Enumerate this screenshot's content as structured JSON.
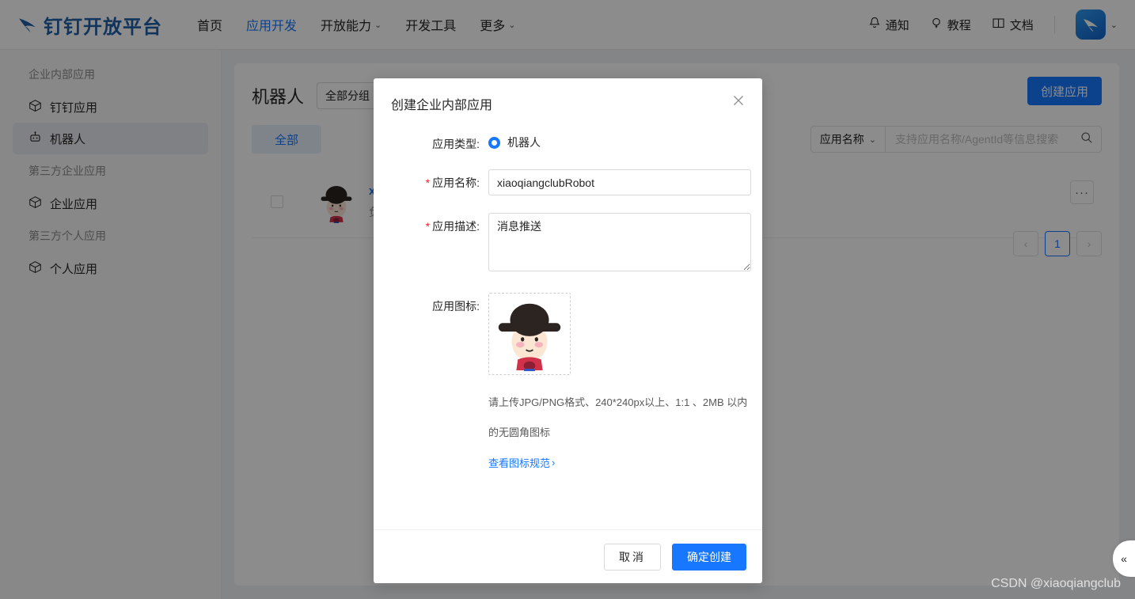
{
  "header": {
    "logo_text": "钉钉开放平台",
    "logo_icon": "dingtalk-wing-logo",
    "nav": [
      {
        "label": "首页",
        "active": false,
        "caret": ""
      },
      {
        "label": "应用开发",
        "active": true,
        "caret": ""
      },
      {
        "label": "开放能力",
        "active": false,
        "caret": "⌄"
      },
      {
        "label": "开发工具",
        "active": false,
        "caret": ""
      },
      {
        "label": "更多",
        "active": false,
        "caret": "⌄"
      }
    ],
    "tools": [
      {
        "label": "通知",
        "icon": "bell-icon"
      },
      {
        "label": "教程",
        "icon": "lightbulb-icon"
      },
      {
        "label": "文档",
        "icon": "book-icon"
      }
    ],
    "avatar_icon": "dingtalk-avatar",
    "avatar_caret": "⌄"
  },
  "sidebar": {
    "groups": [
      {
        "title": "企业内部应用",
        "items": [
          {
            "label": "钉钉应用",
            "icon": "cube-icon",
            "active": false
          },
          {
            "label": "机器人",
            "icon": "robot-icon",
            "active": true
          }
        ]
      },
      {
        "title": "第三方企业应用",
        "items": [
          {
            "label": "企业应用",
            "icon": "cube-icon",
            "active": false
          }
        ]
      },
      {
        "title": "第三方个人应用",
        "items": [
          {
            "label": "个人应用",
            "icon": "cube-icon",
            "active": false
          }
        ]
      }
    ]
  },
  "main": {
    "page_title": "机器人",
    "group_select": {
      "value": "全部分组",
      "caret": "⌄"
    },
    "create_app_label": "创建应用",
    "tab_all": "全部",
    "search": {
      "scope_label": "应用名称",
      "scope_caret": "⌄",
      "placeholder": "支持应用名称/AgentId等信息搜索",
      "value": "",
      "icon": "search-icon"
    },
    "app_row": {
      "name": "xiaoqiangclubRobot",
      "sub": "负责人：xiaoqiangclub",
      "more_label": "···",
      "avatar_icon": "robot-character-avatar"
    },
    "pagination": {
      "prev": "‹",
      "next": "›",
      "pages": [
        "1"
      ],
      "current": "1"
    },
    "collapse_icon": "«",
    "watermark": "CSDN @xiaoqiangclub"
  },
  "modal": {
    "title": "创建企业内部应用",
    "close_icon": "close-icon",
    "fields": {
      "app_type": {
        "label": "应用类型:",
        "required": false,
        "option": "机器人",
        "selected": true
      },
      "app_name": {
        "label": "应用名称:",
        "required": true,
        "value": "xiaoqiangclubRobot",
        "placeholder": ""
      },
      "app_desc": {
        "label": "应用描述:",
        "required": true,
        "value": "消息推送",
        "placeholder": ""
      },
      "app_icon": {
        "label": "应用图标:",
        "required": false,
        "icon_name": "robot-character-avatar",
        "hint": "请上传JPG/PNG格式、240*240px以上、1:1 、2MB 以内的无圆角图标",
        "link": "查看图标规范",
        "link_caret": "›"
      }
    },
    "buttons": {
      "cancel": "取消",
      "confirm": "确定创建"
    }
  },
  "colors": {
    "brand_blue": "#1777ff",
    "logo_blue": "#1f5fa8",
    "required_red": "#f5222d",
    "tab_bg": "#e8f0fb"
  }
}
